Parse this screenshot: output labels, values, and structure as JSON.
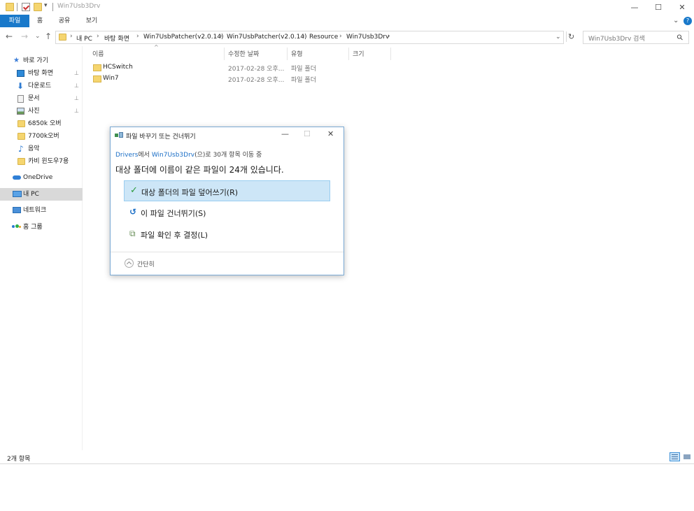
{
  "window": {
    "title": "Win7Usb3Drv",
    "minimize": "—",
    "maximize": "☐",
    "close": "✕"
  },
  "ribbon": {
    "tabs": [
      "파일",
      "홈",
      "공유",
      "보기"
    ],
    "chevron": "⌄",
    "help": "?"
  },
  "nav": {
    "back": "←",
    "forward": "→",
    "dropdown": "⌄",
    "up": "↑",
    "breadcrumbs": [
      "내 PC",
      "바탕 화면",
      "Win7UsbPatcher(v2.0.14)",
      "Win7UsbPatcher(v2.0.14)",
      "Resource",
      "Win7Usb3Drv"
    ],
    "separator": "›",
    "refresh": "↻",
    "search_placeholder": "Win7Usb3Drv 검색",
    "search_icon": "⚲"
  },
  "sidebar": {
    "items": [
      {
        "label": "바로 가기",
        "icon": "star-icon",
        "pinned": false
      },
      {
        "label": "바탕 화면",
        "icon": "desktop-icon",
        "pinned": true
      },
      {
        "label": "다운로드",
        "icon": "download-icon",
        "pinned": true
      },
      {
        "label": "문서",
        "icon": "document-icon",
        "pinned": true
      },
      {
        "label": "사진",
        "icon": "pictures-icon",
        "pinned": true
      },
      {
        "label": "6850k 오버",
        "icon": "folder-icon",
        "pinned": false
      },
      {
        "label": "7700k오버",
        "icon": "folder-icon",
        "pinned": false
      },
      {
        "label": "음악",
        "icon": "music-icon",
        "pinned": false
      },
      {
        "label": "카비 윈도우7용",
        "icon": "folder-icon",
        "pinned": false
      },
      {
        "label": "OneDrive",
        "icon": "onedrive-icon",
        "pinned": false
      },
      {
        "label": "내 PC",
        "icon": "pc-icon",
        "pinned": false
      },
      {
        "label": "네트워크",
        "icon": "network-icon",
        "pinned": false
      },
      {
        "label": "홈 그룹",
        "icon": "homegroup-icon",
        "pinned": false
      }
    ],
    "pin_glyph": "📌"
  },
  "columns": {
    "name": "이름",
    "modified": "수정한 날짜",
    "type": "유형",
    "size": "크기"
  },
  "files": [
    {
      "name": "HCSwitch",
      "modified": "2017-02-28 오후...",
      "type": "파일 폴더"
    },
    {
      "name": "Win7",
      "modified": "2017-02-28 오후...",
      "type": "파일 폴더"
    }
  ],
  "status": {
    "count": "2개 항목"
  },
  "dialog": {
    "title": "파일 바꾸기 또는 건너뛰기",
    "from": "Drivers",
    "from_suffix": "에서 ",
    "to": "Win7Usb3Drv",
    "to_suffix": "(으)로 30개 항목 이동 중",
    "heading": "대상 폴더에 이름이 같은 파일이 24개 있습니다.",
    "options": [
      {
        "label": "대상 폴더의 파일 덮어쓰기(R)",
        "glyph": "✓"
      },
      {
        "label": "이 파일 건너뛰기(S)",
        "glyph": "↺"
      },
      {
        "label": "파일 확인 후 결정(L)",
        "glyph": "⧉"
      }
    ],
    "less_details": "간단히",
    "minimize": "—",
    "maximize": "☐",
    "close": "✕"
  },
  "colors": {
    "accent": "#1979ca",
    "selected_option": "#cde6f7",
    "link": "#1a6ec6"
  }
}
